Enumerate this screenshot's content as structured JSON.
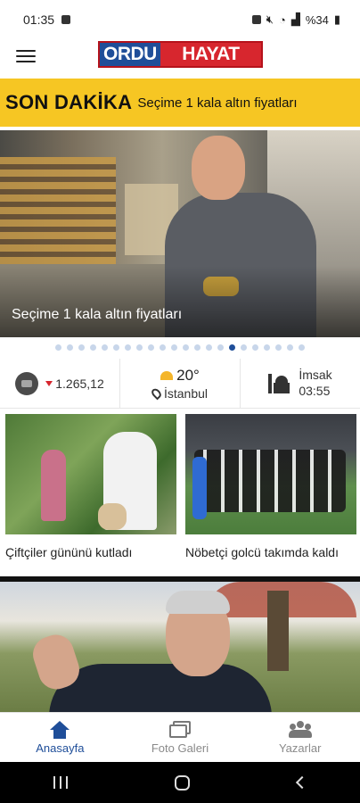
{
  "status_bar": {
    "time": "01:35",
    "battery": "%34",
    "icons": [
      "notification-icon",
      "alarm-icon",
      "mute-icon",
      "wifi-icon",
      "signal-icon",
      "battery-icon"
    ]
  },
  "header": {
    "logo_part1": "ORDU",
    "logo_part2": "HAYAT",
    "colors": {
      "logo_blue": "#1f4e99",
      "logo_red": "#d7262e"
    }
  },
  "breaking": {
    "label": "SON DAKİKA",
    "headline": "Seçime 1 kala altın fiyatları",
    "color": "#f6c623"
  },
  "slider": {
    "caption": "Seçime 1 kala altın fiyatları",
    "dot_count": 22,
    "active_index": 15
  },
  "info": {
    "gold_price": "1.265,12",
    "temperature": "20°",
    "city": "İstanbul",
    "prayer_name": "İmsak",
    "prayer_time": "03:55"
  },
  "cards": [
    {
      "title": "Çiftçiler gününü kutladı"
    },
    {
      "title": "Nöbetçi golcü takımda kaldı"
    }
  ],
  "bottom_nav": {
    "items": [
      {
        "label": "Anasayfa",
        "icon": "home-icon",
        "active": true
      },
      {
        "label": "Foto Galeri",
        "icon": "gallery-icon",
        "active": false
      },
      {
        "label": "Yazarlar",
        "icon": "writers-icon",
        "active": false
      }
    ]
  }
}
